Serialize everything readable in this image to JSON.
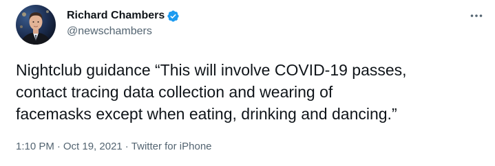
{
  "author": {
    "display_name": "Richard Chambers",
    "handle": "@newschambers",
    "verified_icon": "verified-badge-icon",
    "verified_color": "#1d9bf0"
  },
  "menu": {
    "more_icon": "more-options-icon"
  },
  "tweet": {
    "lines": [
      "Nightclub guidance “This will involve COVID-19 passes,",
      "contact tracing data collection and wearing of",
      "facemasks except when eating, drinking and dancing.”"
    ]
  },
  "meta": {
    "time": "1:10 PM",
    "date": "Oct 19, 2021",
    "source": "Twitter for iPhone",
    "separator": "·"
  },
  "colors": {
    "text_primary": "#0f1419",
    "text_secondary": "#536471",
    "accent": "#1d9bf0"
  }
}
